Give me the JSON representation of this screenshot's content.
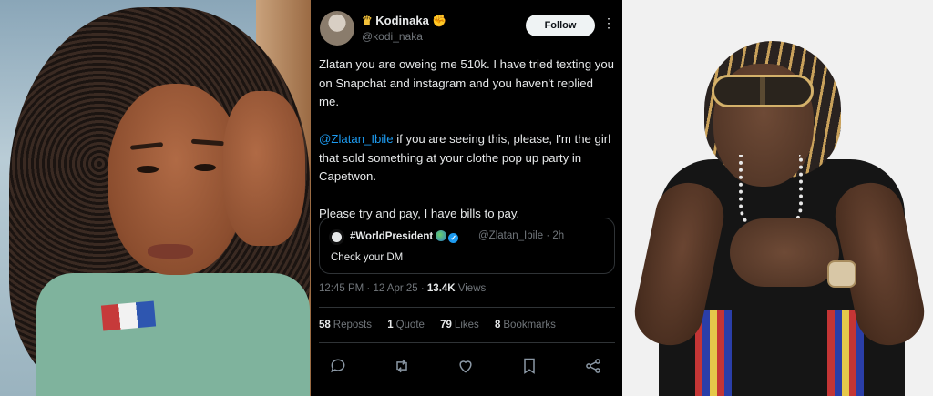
{
  "tweet": {
    "display_name": "Kodinaka",
    "handle": "@kodi_naka",
    "follow_label": "Follow",
    "more_label": "⋮",
    "paragraph1": "Zlatan you are oweing me 510k. I have tried texting you on Snapchat and instagram and you haven't replied me.",
    "paragraph2_mention": "@Zlatan_Ibile",
    "paragraph2_rest": " if you are seeing this, please, I'm the girl that sold something at your clothe pop up party in Capetwon.",
    "paragraph3": "Please try and pay, I have bills to pay.",
    "quote": {
      "display_name": "#WorldPresident",
      "handle_time": "@Zlatan_Ibile · 2h",
      "text": "Check your DM"
    },
    "time": "12:45 PM · 12 Apr 25 · ",
    "views_count": "13.4K",
    "views_label": " Views",
    "stats": {
      "reposts_count": "58",
      "reposts_label": "Reposts",
      "quotes_count": "1",
      "quotes_label": "Quote",
      "likes_count": "79",
      "likes_label": "Likes",
      "bookmarks_count": "8",
      "bookmarks_label": "Bookmarks"
    },
    "colors": {
      "background": "#000000",
      "text": "#e7e9ea",
      "muted": "#71767b",
      "link": "#1d9bf0"
    },
    "icons": [
      "reply-icon",
      "repost-icon",
      "like-icon",
      "bookmark-icon",
      "share-icon"
    ]
  }
}
